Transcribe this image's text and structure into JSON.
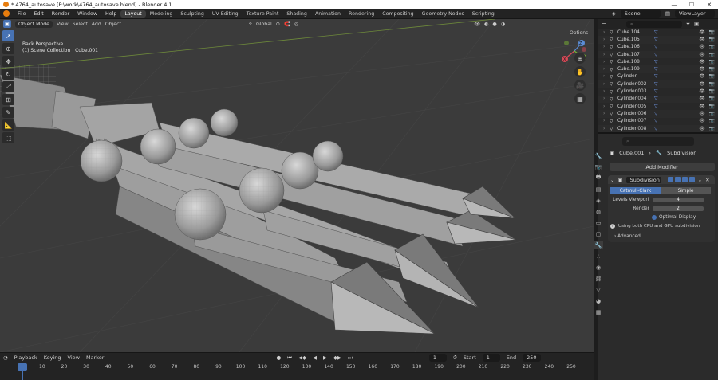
{
  "window": {
    "title": "* 4764_autosave [F:\\work\\4764_autosave.blend] - Blender 4.1",
    "minimize": "—",
    "maximize": "☐",
    "close": "✕"
  },
  "menus": [
    "File",
    "Edit",
    "Render",
    "Window",
    "Help"
  ],
  "workspaces": [
    "Layout",
    "Modeling",
    "Sculpting",
    "UV Editing",
    "Texture Paint",
    "Shading",
    "Animation",
    "Rendering",
    "Compositing",
    "Geometry Nodes",
    "Scripting"
  ],
  "active_workspace": "Layout",
  "scene": {
    "label": "Scene",
    "view_layer": "ViewLayer"
  },
  "viewport": {
    "mode": "Object Mode",
    "menus": [
      "View",
      "Select",
      "Add",
      "Object"
    ],
    "orientation": "Global",
    "options": "Options",
    "info_line1": "Back Perspective",
    "info_line2": "(1) Scene Collection | Cube.001",
    "axis_x": "X",
    "axis_y": "Y",
    "axis_z": "Z"
  },
  "outliner": {
    "items": [
      {
        "name": "Cube.104",
        "mod": true
      },
      {
        "name": "Cube.105",
        "mod": true
      },
      {
        "name": "Cube.106",
        "mod": true
      },
      {
        "name": "Cube.107",
        "mod": true
      },
      {
        "name": "Cube.108",
        "mod": true
      },
      {
        "name": "Cube.109",
        "mod": true
      },
      {
        "name": "Cylinder",
        "mod": true
      },
      {
        "name": "Cylinder.002",
        "mod": true
      },
      {
        "name": "Cylinder.003",
        "mod": true
      },
      {
        "name": "Cylinder.004",
        "mod": true
      },
      {
        "name": "Cylinder.005",
        "mod": true
      },
      {
        "name": "Cylinder.006",
        "mod": true
      },
      {
        "name": "Cylinder.007",
        "mod": true
      },
      {
        "name": "Cylinder.008",
        "mod": true
      }
    ]
  },
  "properties": {
    "breadcrumb_object": "Cube.001",
    "breadcrumb_modifier": "Subdivision",
    "add_modifier": "Add Modifier",
    "modifier_name": "Subdivision",
    "catmull": "Catmull-Clark",
    "simple": "Simple",
    "levels_viewport_label": "Levels Viewport",
    "levels_viewport": "4",
    "render_label": "Render",
    "render": "2",
    "optimal_display": "Optimal Display",
    "info": "Using both CPU and GPU subdivision",
    "advanced": "Advanced"
  },
  "timeline": {
    "menus": [
      "Playback",
      "Keying",
      "View",
      "Marker"
    ],
    "current": "1",
    "start_label": "Start",
    "start": "1",
    "end_label": "End",
    "end": "250",
    "ticks": [
      "10",
      "20",
      "30",
      "40",
      "50",
      "60",
      "70",
      "80",
      "90",
      "100",
      "110",
      "120",
      "130",
      "140",
      "150",
      "160",
      "170",
      "180",
      "190",
      "200",
      "210",
      "220",
      "230",
      "240",
      "250"
    ]
  },
  "colors": {
    "accent": "#4772b3",
    "brand": "#e87d0d",
    "viewport_bg": "#3b3b3b"
  }
}
